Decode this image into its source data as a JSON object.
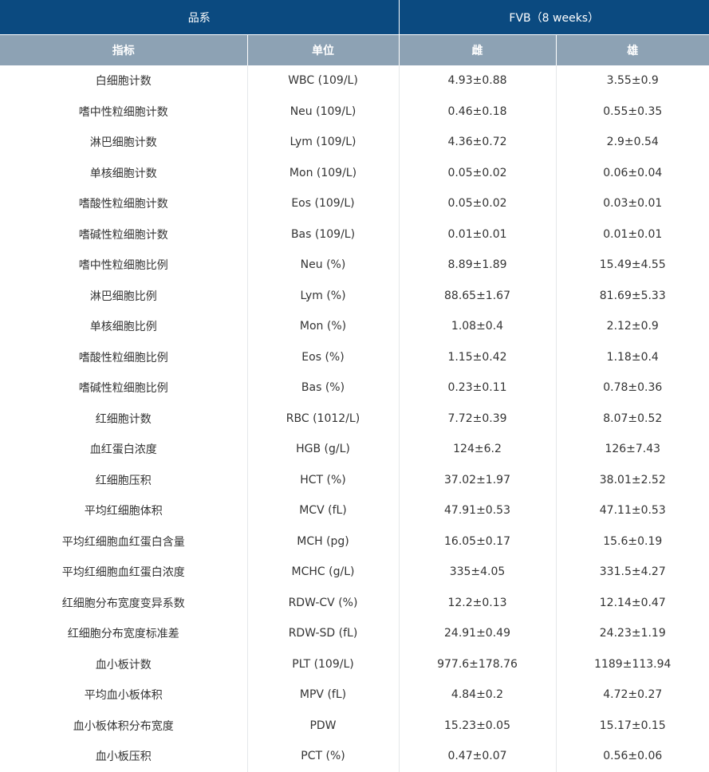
{
  "table": {
    "header_top": {
      "strain_label": "品系",
      "strain_value": "FVB（8 weeks）"
    },
    "header_sub": {
      "indicator": "指标",
      "unit": "单位",
      "female": "雌",
      "male": "雄"
    },
    "rows": [
      {
        "indicator": "白细胞计数",
        "unit": "WBC (109/L)",
        "female": "4.93±0.88",
        "male": "3.55±0.9"
      },
      {
        "indicator": "嗜中性粒细胞计数",
        "unit": "Neu (109/L)",
        "female": "0.46±0.18",
        "male": "0.55±0.35"
      },
      {
        "indicator": "淋巴细胞计数",
        "unit": "Lym (109/L)",
        "female": "4.36±0.72",
        "male": "2.9±0.54"
      },
      {
        "indicator": "单核细胞计数",
        "unit": "Mon (109/L)",
        "female": "0.05±0.02",
        "male": "0.06±0.04"
      },
      {
        "indicator": "嗜酸性粒细胞计数",
        "unit": "Eos (109/L)",
        "female": "0.05±0.02",
        "male": "0.03±0.01"
      },
      {
        "indicator": "嗜碱性粒细胞计数",
        "unit": "Bas (109/L)",
        "female": "0.01±0.01",
        "male": "0.01±0.01"
      },
      {
        "indicator": "嗜中性粒细胞比例",
        "unit": "Neu (%)",
        "female": "8.89±1.89",
        "male": "15.49±4.55"
      },
      {
        "indicator": "淋巴细胞比例",
        "unit": "Lym (%)",
        "female": "88.65±1.67",
        "male": "81.69±5.33"
      },
      {
        "indicator": "单核细胞比例",
        "unit": "Mon (%)",
        "female": "1.08±0.4",
        "male": "2.12±0.9"
      },
      {
        "indicator": "嗜酸性粒细胞比例",
        "unit": "Eos (%)",
        "female": "1.15±0.42",
        "male": "1.18±0.4"
      },
      {
        "indicator": "嗜碱性粒细胞比例",
        "unit": "Bas (%)",
        "female": "0.23±0.11",
        "male": "0.78±0.36"
      },
      {
        "indicator": "红细胞计数",
        "unit": "RBC (1012/L)",
        "female": "7.72±0.39",
        "male": "8.07±0.52"
      },
      {
        "indicator": "血红蛋白浓度",
        "unit": "HGB (g/L)",
        "female": "124±6.2",
        "male": "126±7.43"
      },
      {
        "indicator": "红细胞压积",
        "unit": "HCT (%)",
        "female": "37.02±1.97",
        "male": "38.01±2.52"
      },
      {
        "indicator": "平均红细胞体积",
        "unit": "MCV (fL)",
        "female": "47.91±0.53",
        "male": "47.11±0.53"
      },
      {
        "indicator": "平均红细胞血红蛋白含量",
        "unit": "MCH (pg)",
        "female": "16.05±0.17",
        "male": "15.6±0.19"
      },
      {
        "indicator": "平均红细胞血红蛋白浓度",
        "unit": "MCHC (g/L)",
        "female": "335±4.05",
        "male": "331.5±4.27"
      },
      {
        "indicator": "红细胞分布宽度变异系数",
        "unit": "RDW-CV (%)",
        "female": "12.2±0.13",
        "male": "12.14±0.47"
      },
      {
        "indicator": "红细胞分布宽度标准差",
        "unit": "RDW-SD (fL)",
        "female": "24.91±0.49",
        "male": "24.23±1.19"
      },
      {
        "indicator": "血小板计数",
        "unit": "PLT (109/L)",
        "female": "977.6±178.76",
        "male": "1189±113.94"
      },
      {
        "indicator": "平均血小板体积",
        "unit": "MPV (fL)",
        "female": "4.84±0.2",
        "male": "4.72±0.27"
      },
      {
        "indicator": "血小板体积分布宽度",
        "unit": "PDW",
        "female": "15.23±0.05",
        "male": "15.17±0.15"
      },
      {
        "indicator": "血小板压积",
        "unit": "PCT (%)",
        "female": "0.47±0.07",
        "male": "0.56±0.06"
      }
    ]
  }
}
